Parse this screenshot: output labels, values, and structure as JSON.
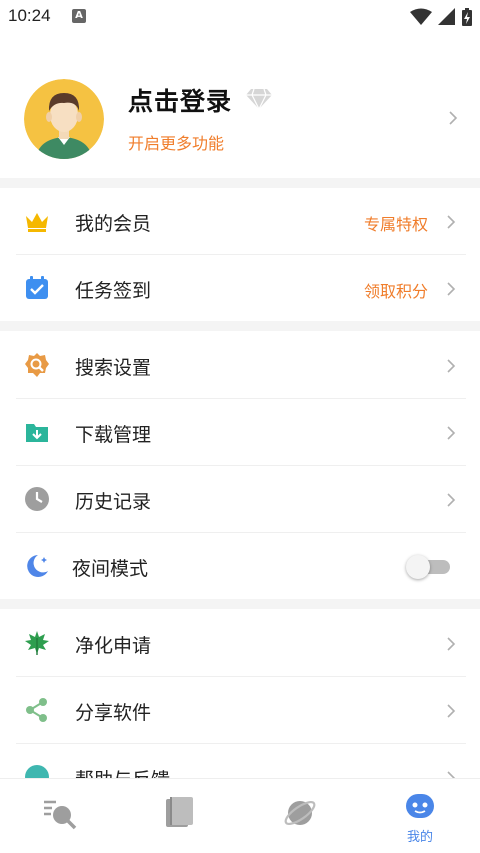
{
  "status_bar": {
    "time": "10:24",
    "notification_letter": "A"
  },
  "profile": {
    "title": "点击登录",
    "subtitle": "开启更多功能"
  },
  "menu": {
    "group1": [
      {
        "label": "我的会员",
        "extra": "专属特权",
        "icon": "crown-icon"
      },
      {
        "label": "任务签到",
        "extra": "领取积分",
        "icon": "calendar-check-icon"
      }
    ],
    "group2": [
      {
        "label": "搜索设置",
        "icon": "search-gear-icon"
      },
      {
        "label": "下载管理",
        "icon": "download-folder-icon"
      },
      {
        "label": "历史记录",
        "icon": "clock-icon"
      },
      {
        "label": "夜间模式",
        "icon": "moon-icon",
        "toggle": false
      }
    ],
    "group3": [
      {
        "label": "净化申请",
        "icon": "leaf-icon"
      },
      {
        "label": "分享软件",
        "icon": "share-icon"
      },
      {
        "label": "帮助与反馈",
        "icon": "help-icon"
      }
    ]
  },
  "bottom_nav": {
    "items": [
      {
        "icon": "search-list-icon",
        "active": false
      },
      {
        "icon": "book-icon",
        "active": false
      },
      {
        "icon": "planet-icon",
        "active": false
      },
      {
        "icon": "robot-face-icon",
        "label": "我的",
        "active": true
      }
    ]
  },
  "colors": {
    "accent": "#f07d2b",
    "active_nav": "#4a86e8",
    "divider": "#f4f4f4"
  }
}
